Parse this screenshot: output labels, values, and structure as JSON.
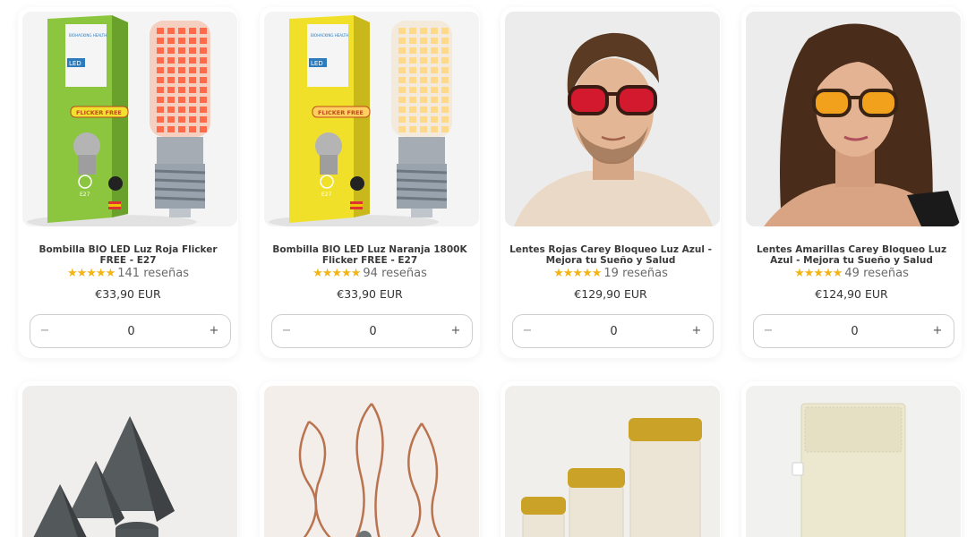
{
  "products": [
    {
      "title": "Bombilla BIO LED Luz Roja Flicker FREE - E27",
      "stars": "★★★★★",
      "reviews": "141 reseñas",
      "rating": 5,
      "price": "€33,90 EUR",
      "quantity": "0",
      "box_label": "FLICKER FREE",
      "box_sub": "LED",
      "box_brand": "BIOHACKING HEALTH",
      "box_socket": "E27"
    },
    {
      "title": "Bombilla BIO LED Luz Naranja 1800K Flicker FREE - E27",
      "stars": "★★★★★",
      "reviews": "94 reseñas",
      "rating": 5,
      "price": "€33,90 EUR",
      "quantity": "0",
      "box_label": "FLICKER FREE",
      "box_sub": "LED",
      "box_brand": "BIOHACKING HEALTH",
      "box_socket": "E27"
    },
    {
      "title": "Lentes Rojas Carey Bloqueo Luz Azul - Mejora tu Sueño y Salud",
      "stars": "★★★★★",
      "reviews": "19 reseñas",
      "rating": 4.5,
      "price": "€129,90 EUR",
      "quantity": "0"
    },
    {
      "title": "Lentes Amarillas Carey Bloqueo Luz Azul - Mejora tu Sueño y Salud",
      "stars": "★★★★★",
      "reviews": "49 reseñas",
      "rating": 5,
      "price": "€124,90 EUR",
      "quantity": "0"
    }
  ],
  "qty_controls": {
    "minus": "−",
    "plus": "+"
  },
  "colors": {
    "star": "#f2b416",
    "green_box": "#8cc63f",
    "yellow_box": "#f1e02a",
    "red_led": "#ff6b4a",
    "amber_led": "#ffd98a"
  }
}
